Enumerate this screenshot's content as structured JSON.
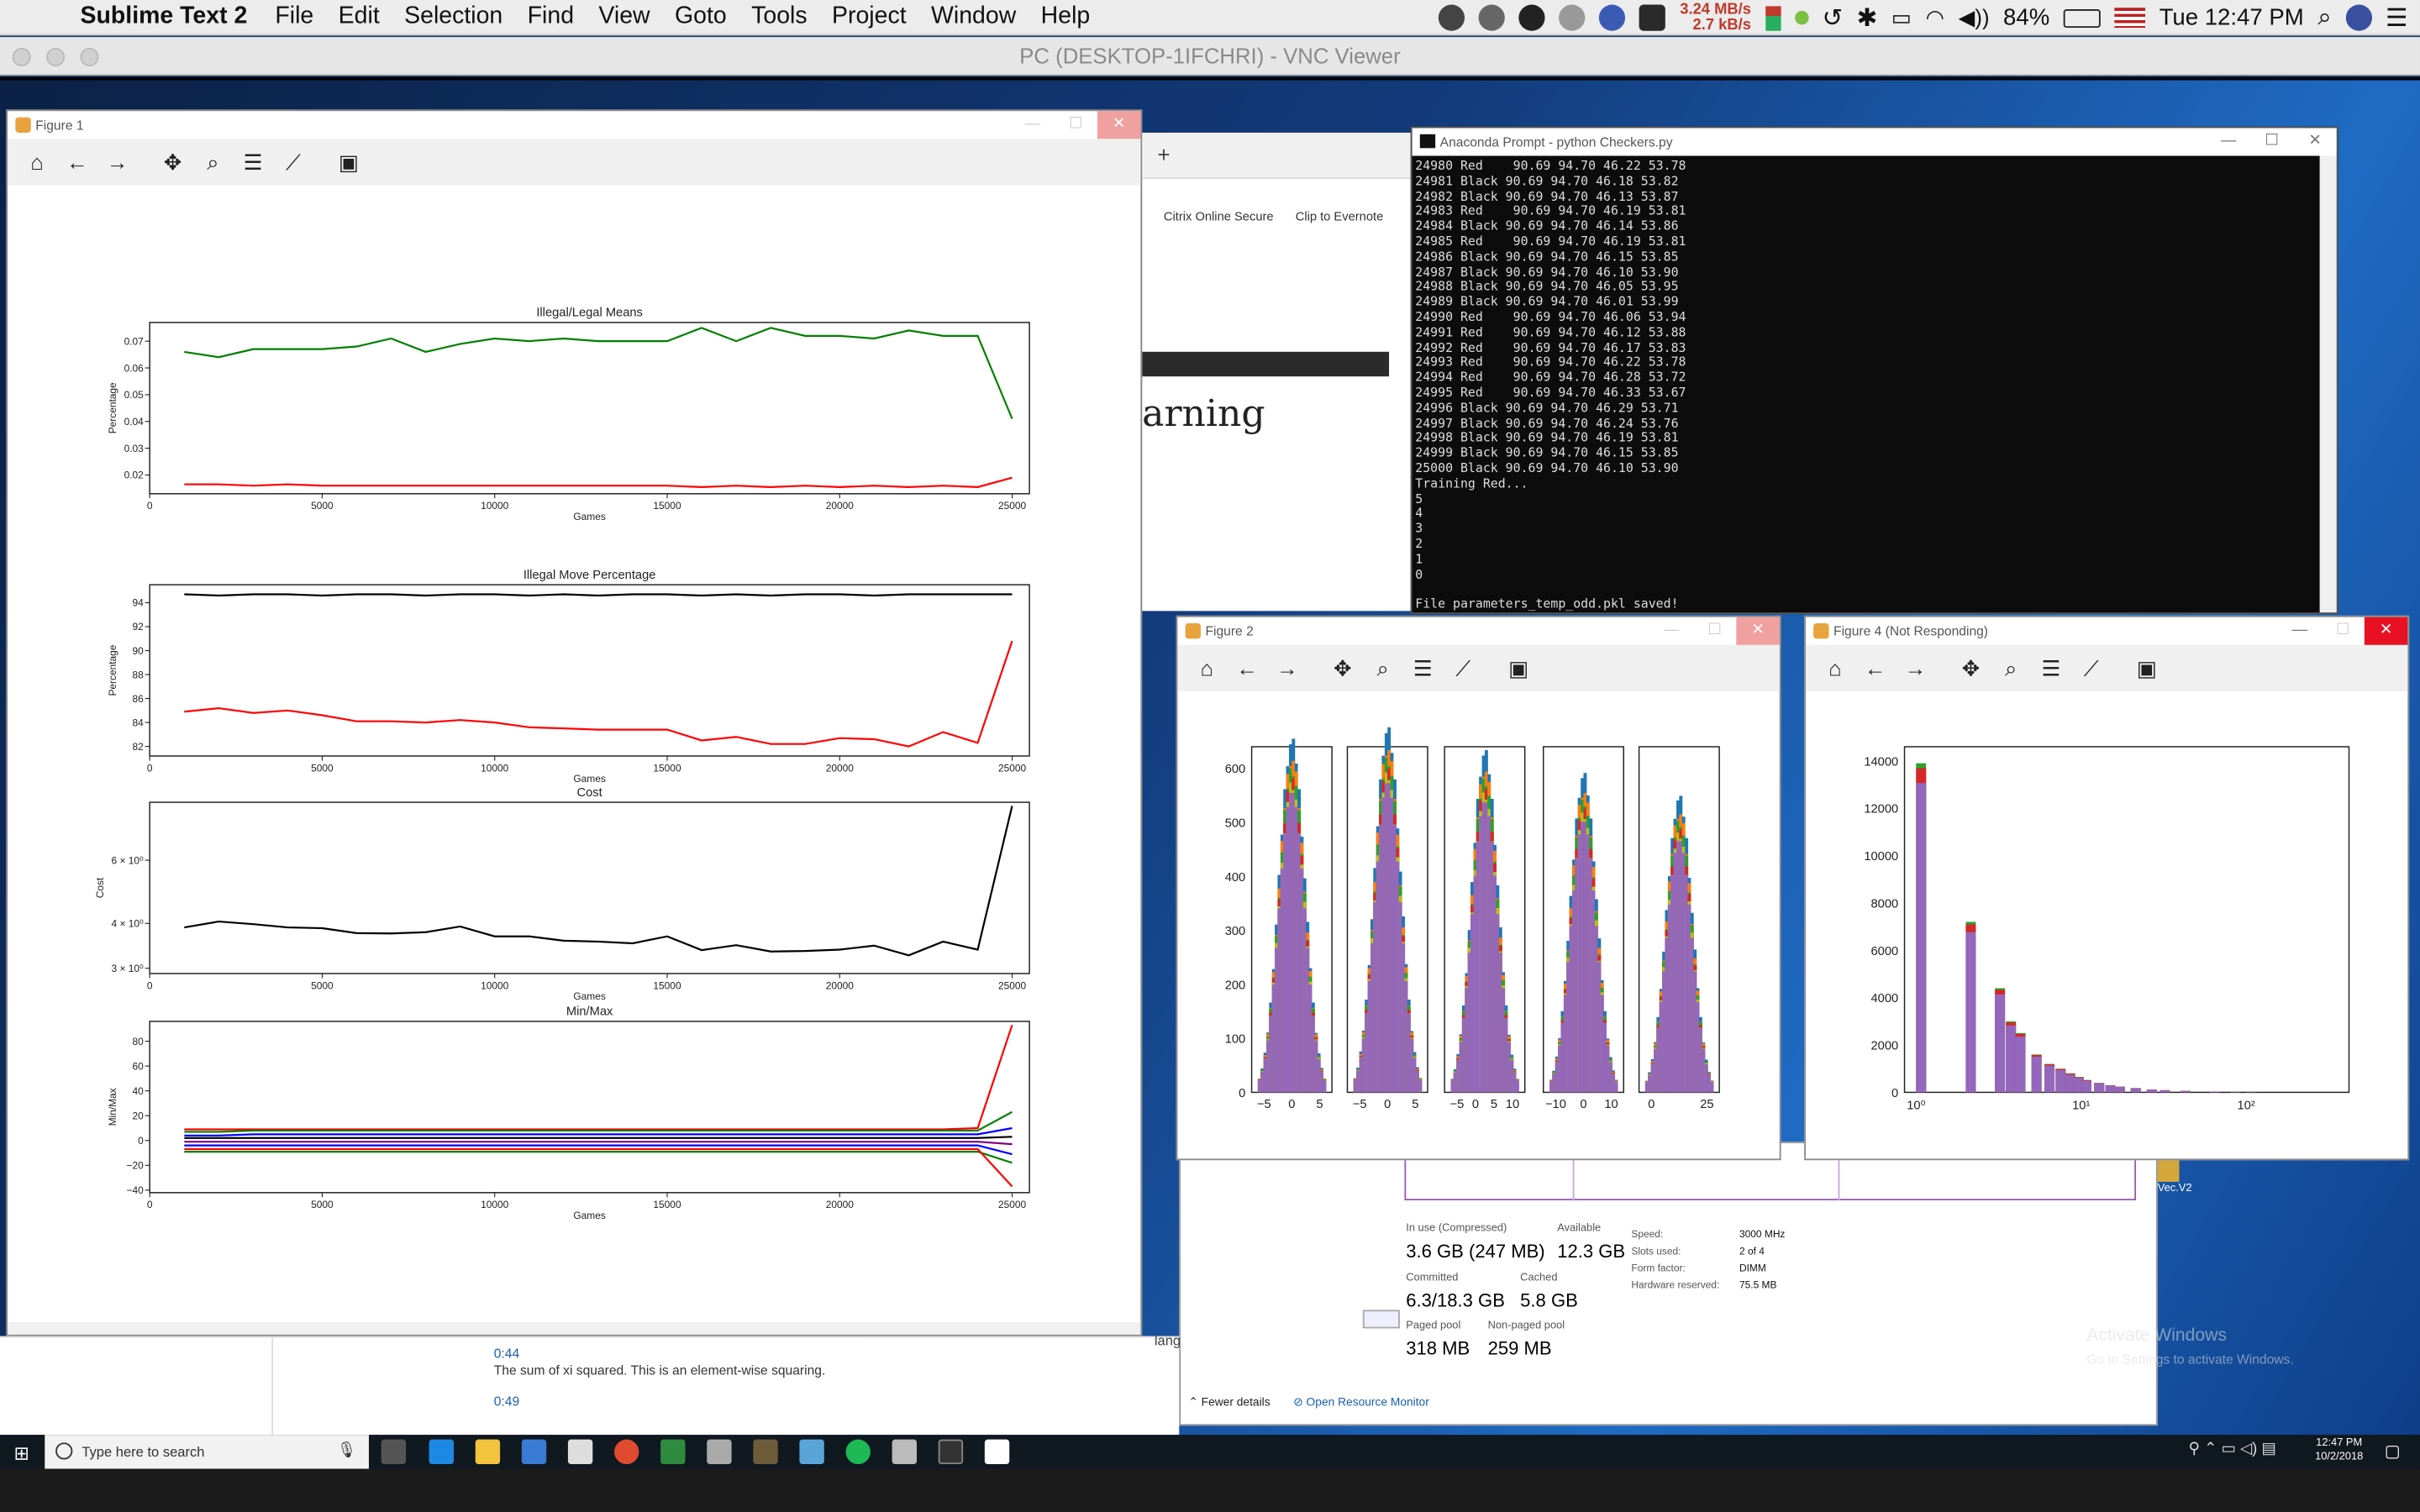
{
  "menubar": {
    "app": "Sublime Text 2",
    "items": [
      "File",
      "Edit",
      "Selection",
      "Find",
      "View",
      "Goto",
      "Tools",
      "Project",
      "Window",
      "Help"
    ],
    "net_up": "3.24 MB/s",
    "net_down": "2.7 kB/s",
    "battery": "84%",
    "clock": "Tue 12:47 PM"
  },
  "vnc": {
    "title": "PC (DESKTOP-1IFCHRI) - VNC Viewer"
  },
  "figure1": {
    "title": "Figure 1",
    "plots": [
      {
        "title": "Illegal/Legal Means",
        "ylabel": "Percentage",
        "xlabel": "Games",
        "yticks": [
          "0.07",
          "0.06",
          "0.05",
          "0.04",
          "0.03",
          "0.02"
        ],
        "xticks": [
          "0",
          "5000",
          "10000",
          "15000",
          "20000",
          "25000"
        ]
      },
      {
        "title": "Illegal Move Percentage",
        "ylabel": "Percentage",
        "xlabel": "Games",
        "yticks": [
          "94",
          "92",
          "90",
          "88",
          "86",
          "84",
          "82"
        ],
        "xticks": [
          "0",
          "5000",
          "10000",
          "15000",
          "20000",
          "25000"
        ]
      },
      {
        "title": "Cost",
        "ylabel": "Cost",
        "xlabel": "Games",
        "yticks": [
          "6 × 10⁰",
          "4 × 10⁰",
          "3 × 10⁰"
        ],
        "xticks": [
          "0",
          "5000",
          "10000",
          "15000",
          "20000",
          "25000"
        ]
      },
      {
        "title": "Min/Max",
        "ylabel": "Min/Max",
        "xlabel": "Games",
        "yticks": [
          "80",
          "60",
          "40",
          "20",
          "0",
          "−20",
          "−40"
        ],
        "xticks": [
          "0",
          "5000",
          "10000",
          "15000",
          "20000",
          "25000"
        ]
      }
    ]
  },
  "chart_data": [
    {
      "type": "line",
      "title": "Illegal/Legal Means",
      "xlabel": "Games",
      "ylabel": "Percentage",
      "xlim": [
        0,
        25500
      ],
      "ylim": [
        0.013,
        0.077
      ],
      "x": [
        1000,
        2000,
        3000,
        4000,
        5000,
        6000,
        7000,
        8000,
        9000,
        10000,
        11000,
        12000,
        13000,
        14000,
        15000,
        16000,
        17000,
        18000,
        19000,
        20000,
        21000,
        22000,
        23000,
        24000,
        25000
      ],
      "series": [
        {
          "color": "#008000",
          "values": [
            0.066,
            0.064,
            0.067,
            0.067,
            0.067,
            0.068,
            0.071,
            0.066,
            0.069,
            0.071,
            0.07,
            0.071,
            0.07,
            0.07,
            0.07,
            0.075,
            0.07,
            0.075,
            0.072,
            0.072,
            0.071,
            0.074,
            0.072,
            0.072,
            0.041
          ]
        },
        {
          "color": "#ff0000",
          "values": [
            0.0165,
            0.0165,
            0.016,
            0.0165,
            0.016,
            0.016,
            0.016,
            0.016,
            0.016,
            0.016,
            0.016,
            0.016,
            0.016,
            0.016,
            0.016,
            0.0155,
            0.016,
            0.0155,
            0.016,
            0.0155,
            0.016,
            0.0155,
            0.016,
            0.0155,
            0.019
          ]
        }
      ]
    },
    {
      "type": "line",
      "title": "Illegal Move Percentage",
      "xlabel": "Games",
      "ylabel": "Percentage",
      "xlim": [
        0,
        25500
      ],
      "ylim": [
        81.2,
        95.5
      ],
      "x": [
        1000,
        2000,
        3000,
        4000,
        5000,
        6000,
        7000,
        8000,
        9000,
        10000,
        11000,
        12000,
        13000,
        14000,
        15000,
        16000,
        17000,
        18000,
        19000,
        20000,
        21000,
        22000,
        23000,
        24000,
        25000
      ],
      "series": [
        {
          "color": "#000000",
          "values": [
            94.7,
            94.6,
            94.7,
            94.7,
            94.6,
            94.7,
            94.7,
            94.6,
            94.7,
            94.7,
            94.6,
            94.7,
            94.6,
            94.7,
            94.7,
            94.6,
            94.7,
            94.6,
            94.7,
            94.7,
            94.6,
            94.7,
            94.7,
            94.7,
            94.7
          ]
        },
        {
          "color": "#ff0000",
          "values": [
            84.9,
            85.2,
            84.8,
            85.0,
            84.6,
            84.1,
            84.1,
            84.0,
            84.2,
            84.0,
            83.6,
            83.5,
            83.4,
            83.4,
            83.4,
            82.5,
            82.8,
            82.2,
            82.2,
            82.7,
            82.6,
            82.0,
            83.2,
            82.3,
            90.8
          ]
        }
      ]
    },
    {
      "type": "line",
      "title": "Cost",
      "xlabel": "Games",
      "ylabel": "Cost",
      "xlim": [
        0,
        25500
      ],
      "ylim": [
        2.9,
        8.7
      ],
      "log_y": true,
      "x": [
        1000,
        2000,
        3000,
        4000,
        5000,
        6000,
        7000,
        8000,
        9000,
        10000,
        11000,
        12000,
        13000,
        14000,
        15000,
        16000,
        17000,
        18000,
        19000,
        20000,
        21000,
        22000,
        23000,
        24000,
        25000
      ],
      "series": [
        {
          "color": "#000000",
          "values": [
            3.9,
            4.05,
            3.98,
            3.9,
            3.88,
            3.76,
            3.75,
            3.78,
            3.92,
            3.68,
            3.68,
            3.58,
            3.56,
            3.52,
            3.68,
            3.37,
            3.48,
            3.34,
            3.35,
            3.38,
            3.47,
            3.26,
            3.56,
            3.38,
            8.5
          ]
        }
      ]
    },
    {
      "type": "line",
      "title": "Min/Max",
      "xlabel": "Games",
      "ylabel": "Min/Max",
      "xlim": [
        0,
        25500
      ],
      "ylim": [
        -42,
        96
      ],
      "x": [
        1000,
        2000,
        3000,
        4000,
        5000,
        6000,
        7000,
        8000,
        9000,
        10000,
        11000,
        12000,
        13000,
        14000,
        15000,
        16000,
        17000,
        18000,
        19000,
        20000,
        21000,
        22000,
        23000,
        24000,
        25000
      ],
      "series": [
        {
          "color": "#ff0000",
          "values": [
            9,
            9,
            9,
            9,
            9,
            9,
            9,
            9,
            9,
            9,
            9,
            9,
            9,
            9,
            9,
            9,
            9,
            9,
            9,
            9,
            9,
            9,
            9,
            10,
            93
          ]
        },
        {
          "color": "#008000",
          "values": [
            7,
            7,
            8,
            8,
            8,
            8,
            8,
            8,
            8,
            8,
            8,
            8,
            8,
            8,
            8,
            8,
            8,
            8,
            8,
            8,
            8,
            8,
            8,
            8,
            23
          ]
        },
        {
          "color": "#0000ff",
          "values": [
            4,
            4,
            5,
            5,
            5,
            5,
            5,
            5,
            5,
            5,
            5,
            5,
            5,
            5,
            5,
            5,
            5,
            5,
            5,
            5,
            5,
            5,
            5,
            5,
            10
          ]
        },
        {
          "color": "#000000",
          "values": [
            2,
            2,
            2,
            2,
            2,
            2,
            2,
            2,
            2,
            2,
            2,
            2,
            2,
            2,
            2,
            2,
            2,
            2,
            2,
            2,
            2,
            2,
            2,
            2,
            3
          ]
        },
        {
          "color": "#800080",
          "values": [
            -1,
            -1,
            -1,
            -1,
            -1,
            -1,
            -1,
            -1,
            -1,
            -1,
            -1,
            -1,
            -1,
            -1,
            -1,
            -1,
            -1,
            -1,
            -1,
            -1,
            -1,
            -1,
            -1,
            -1,
            -3
          ]
        },
        {
          "color": "#0000ff",
          "values": [
            -4,
            -4,
            -4,
            -4,
            -4,
            -4,
            -4,
            -4,
            -4,
            -4,
            -4,
            -4,
            -4,
            -4,
            -4,
            -4,
            -4,
            -4,
            -4,
            -4,
            -4,
            -4,
            -4,
            -4,
            -11
          ]
        },
        {
          "color": "#008000",
          "values": [
            -9,
            -9,
            -9,
            -9,
            -9,
            -9,
            -9,
            -9,
            -9,
            -9,
            -9,
            -9,
            -9,
            -9,
            -9,
            -9,
            -9,
            -9,
            -9,
            -9,
            -9,
            -9,
            -9,
            -9,
            -18
          ]
        },
        {
          "color": "#ff0000",
          "values": [
            -7,
            -7,
            -7,
            -7,
            -7,
            -7,
            -7,
            -7,
            -7,
            -7,
            -7,
            -7,
            -7,
            -7,
            -7,
            -7,
            -7,
            -7,
            -7,
            -7,
            -7,
            -7,
            -7,
            -7,
            -37
          ]
        }
      ]
    },
    {
      "type": "bar",
      "title": "",
      "note": "Figure 2: five histogram panels",
      "yticks": [
        "600",
        "500",
        "400",
        "300",
        "200",
        "100",
        "0"
      ],
      "panels": [
        {
          "xticks": [
            "−5",
            "0",
            "5"
          ]
        },
        {
          "xticks": [
            "−5",
            "0",
            "5"
          ]
        },
        {
          "xticks": [
            "−5",
            "0",
            "5",
            "10"
          ]
        },
        {
          "xticks": [
            "−10",
            "0",
            "10"
          ]
        },
        {
          "xticks": [
            "0",
            "25"
          ]
        }
      ]
    },
    {
      "type": "bar",
      "title": "",
      "log_x": true,
      "yticks": [
        "14000",
        "12000",
        "10000",
        "8000",
        "6000",
        "4000",
        "2000",
        "0"
      ],
      "xticks": [
        "10⁰",
        "10¹",
        "10²"
      ],
      "categories": [
        1,
        2,
        3,
        3.5,
        4,
        5,
        6,
        7,
        8,
        9,
        10,
        12,
        14,
        16,
        20,
        25,
        30,
        40,
        60,
        80,
        100
      ],
      "values": [
        13900,
        7200,
        4400,
        3000,
        2500,
        1600,
        1200,
        1000,
        800,
        650,
        520,
        400,
        300,
        240,
        180,
        120,
        90,
        60,
        35,
        20,
        10
      ]
    }
  ],
  "browser": {
    "tabs": [
      "Citrix Online Secure",
      "Clip to Evernote"
    ],
    "heading": "arning",
    "plus": "+"
  },
  "terminal": {
    "title": "Anaconda Prompt - python  Checkers.py",
    "lines": [
      "24980 Red    90.69 94.70 46.22 53.78",
      "24981 Black 90.69 94.70 46.18 53.82",
      "24982 Black 90.69 94.70 46.13 53.87",
      "24983 Red    90.69 94.70 46.19 53.81",
      "24984 Black 90.69 94.70 46.14 53.86",
      "24985 Red    90.69 94.70 46.19 53.81",
      "24986 Black 90.69 94.70 46.15 53.85",
      "24987 Black 90.69 94.70 46.10 53.90",
      "24988 Black 90.69 94.70 46.05 53.95",
      "24989 Black 90.69 94.70 46.01 53.99",
      "24990 Red    90.69 94.70 46.06 53.94",
      "24991 Red    90.69 94.70 46.12 53.88",
      "24992 Red    90.69 94.70 46.17 53.83",
      "24993 Red    90.69 94.70 46.22 53.78",
      "24994 Red    90.69 94.70 46.28 53.72",
      "24995 Red    90.69 94.70 46.33 53.67",
      "24996 Black 90.69 94.70 46.29 53.71",
      "24997 Black 90.69 94.70 46.24 53.76",
      "24998 Black 90.69 94.70 46.19 53.81",
      "24999 Black 90.69 94.70 46.15 53.85",
      "25000 Black 90.69 94.70 46.10 53.90",
      "Training Red...",
      "5",
      "4",
      "3",
      "2",
      "1",
      "0",
      "",
      "File parameters_temp_odd.pkl saved!"
    ]
  },
  "figure2": {
    "title": "Figure 2"
  },
  "figure4": {
    "title": "Figure 4 (Not Responding)"
  },
  "taskmgr": {
    "in_use_label": "In use (Compressed)",
    "in_use": "3.6 GB (247 MB)",
    "available_label": "Available",
    "available": "12.3 GB",
    "committed_label": "Committed",
    "committed": "6.3/18.3 GB",
    "cached_label": "Cached",
    "cached": "5.8 GB",
    "paged_label": "Paged pool",
    "paged": "318 MB",
    "nonpaged_label": "Non-paged pool",
    "nonpaged": "259 MB",
    "speed_label": "Speed:",
    "speed": "3000 MHz",
    "slots_label": "Slots used:",
    "slots": "2 of 4",
    "form_label": "Form factor:",
    "form": "DIMM",
    "hw_label": "Hardware reserved:",
    "hw": "75.5 MB",
    "fewer": "Fewer details",
    "resmon": "Open Resource Monitor"
  },
  "transcript": {
    "time1": "0:44",
    "text1": "The sum of xi squared. This is an element-wise squaring.",
    "time2": "0:49",
    "side": "lang"
  },
  "desktop": {
    "activate1": "Activate Windows",
    "activate2": "Go to Settings to activate Windows.",
    "icon_label": "Vec.V2"
  },
  "taskbar": {
    "search": "Type here to search",
    "time": "12:47 PM",
    "date": "10/2/2018"
  }
}
